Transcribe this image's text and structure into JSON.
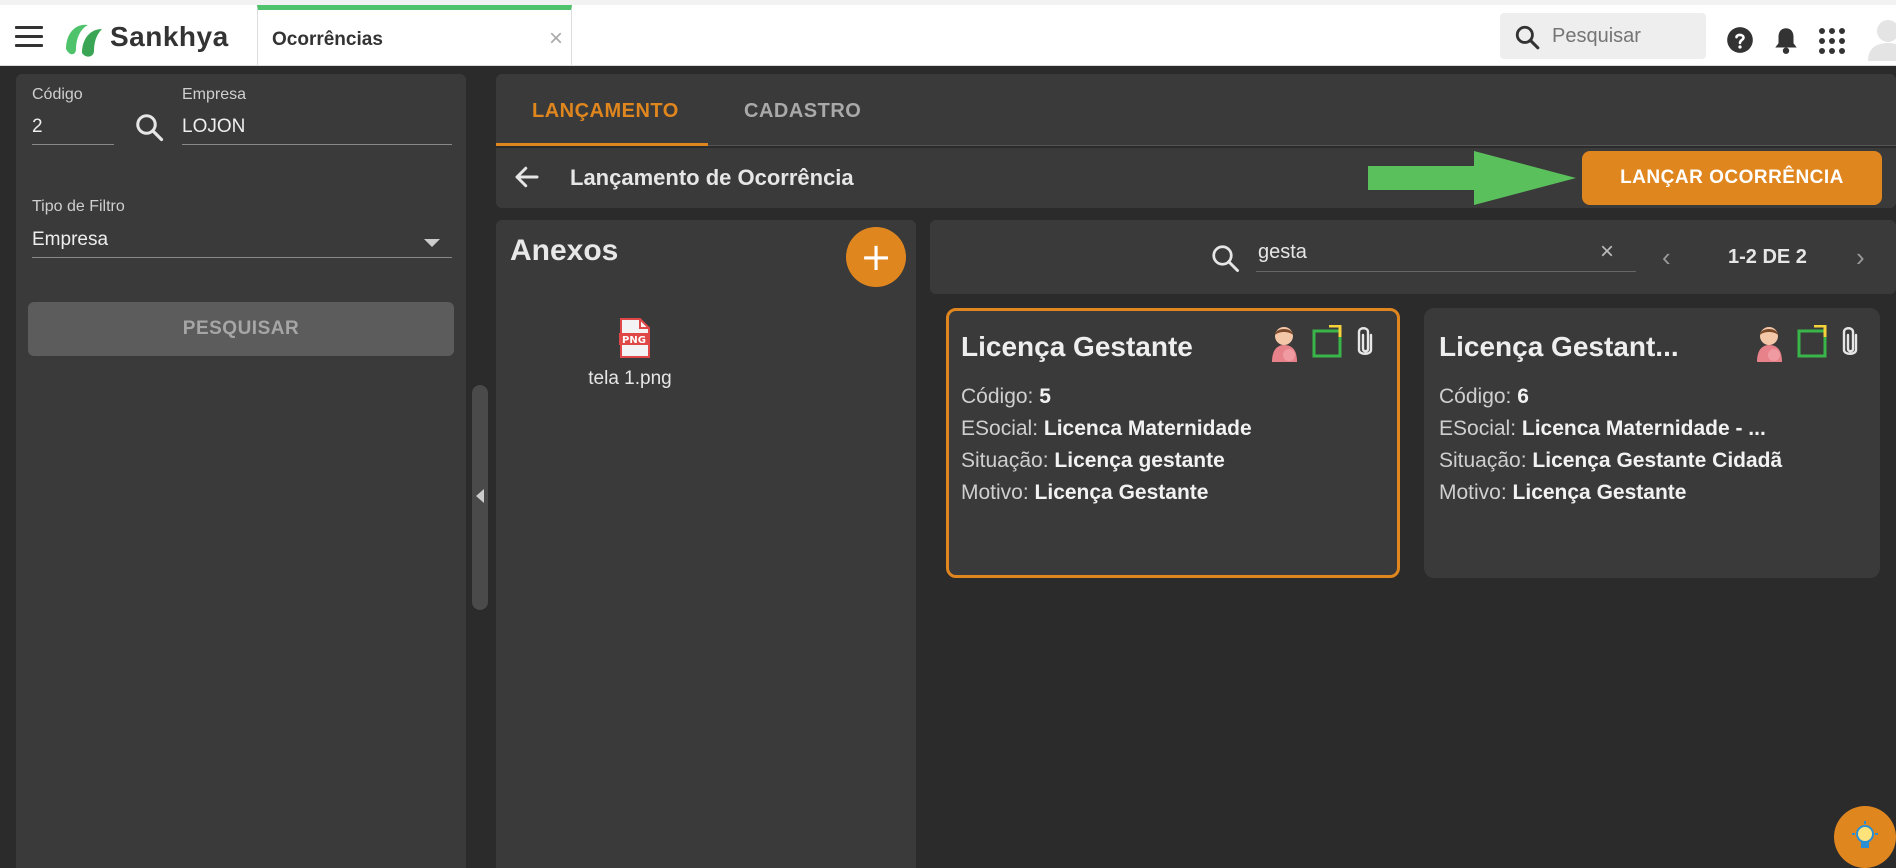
{
  "header": {
    "brand": "Sankhya",
    "tab_label": "Ocorrências",
    "tab_close": "×",
    "search_placeholder": "Pesquisar"
  },
  "filters": {
    "codigo_label": "Código",
    "codigo_value": "2",
    "empresa_label": "Empresa",
    "empresa_value": "LOJON",
    "tipo_label": "Tipo de Filtro",
    "tipo_value": "Empresa",
    "search_button": "PESQUISAR"
  },
  "tabs": [
    {
      "label": "LANÇAMENTO",
      "active": true
    },
    {
      "label": "CADASTRO",
      "active": false
    }
  ],
  "toolbar": {
    "title": "Lançamento de Ocorrência",
    "primary_button": "LANÇAR OCORRÊNCIA"
  },
  "anexos": {
    "title": "Anexos",
    "add_label": "+",
    "file_type": "PNG",
    "file_name": "tela 1.png"
  },
  "search": {
    "value": "gesta",
    "clear": "×",
    "pagination": "1-2 DE 2",
    "prev": "‹",
    "next": "›"
  },
  "cards": [
    {
      "title": "Licença Gestante",
      "codigo_label": "Código:",
      "codigo": "5",
      "esocial_label": "ESocial:",
      "esocial": "Licenca Maternidade",
      "situacao_label": "Situação:",
      "situacao": "Licença gestante",
      "motivo_label": "Motivo:",
      "motivo": "Licença Gestante"
    },
    {
      "title": "Licença Gestant...",
      "codigo_label": "Código:",
      "codigo": "6",
      "esocial_label": "ESocial:",
      "esocial": "Licenca Maternidade - ...",
      "situacao_label": "Situação:",
      "situacao": "Licença Gestante Cidadã",
      "motivo_label": "Motivo:",
      "motivo": "Licença Gestante"
    }
  ],
  "colors": {
    "accent": "#e0861e",
    "brand_green": "#4fc36b",
    "panel": "#3a3a3a",
    "background": "#2b2b2b"
  }
}
